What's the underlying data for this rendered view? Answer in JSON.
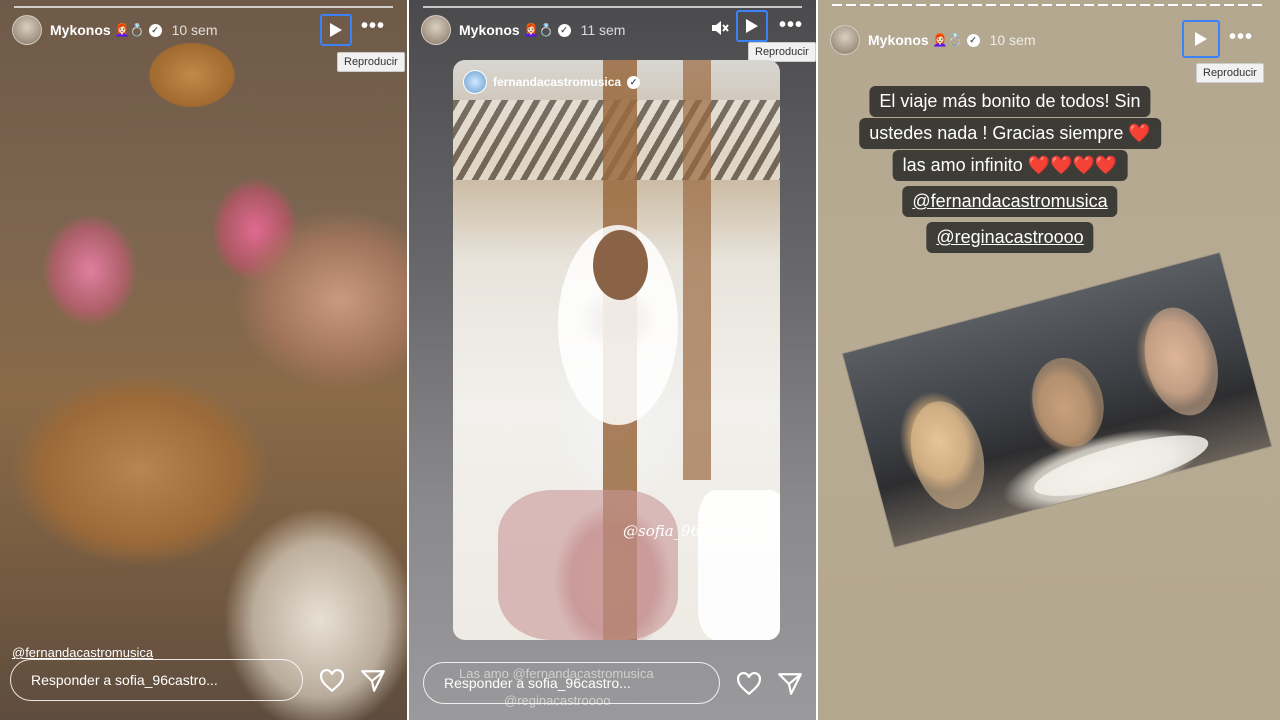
{
  "stories": [
    {
      "username": "Mykonos",
      "emojis": "👩🏻‍🦰💍",
      "age": "10 sem",
      "tooltip": "Reproducir",
      "mention": "@fernandacastromusica",
      "reply_placeholder": "Responder a sofia_96castro..."
    },
    {
      "username": "Mykonos",
      "emojis": "👩🏻‍🦰💍",
      "age": "11 sem",
      "tooltip": "Reproducir",
      "inner_user": "fernandacastromusica",
      "inner_tag": "@sofia_96castro",
      "ghost_text_1": "Las amo @fernandacastromusica",
      "ghost_text_2": "@reginacastroooo",
      "reply_placeholder": "Responder a sofia_96castro..."
    },
    {
      "username": "Mykonos",
      "emojis": "👩🏻‍🦰💍",
      "age": "10 sem",
      "tooltip": "Reproducir",
      "caption": [
        "El viaje más bonito de todos! Sin",
        "ustedes nada ! Gracias siempre ❤️",
        "las amo infinito ❤️❤️❤️❤️",
        "@fernandacastromusica",
        "@reginacastroooo"
      ]
    }
  ],
  "icons": {
    "play": "play-icon",
    "more": "more-icon",
    "mute": "mute-icon",
    "heart": "heart-icon",
    "send": "send-icon",
    "verified": "verified-icon"
  },
  "colors": {
    "focus_outline": "#3b82f6",
    "caption_bg": "#232323"
  }
}
